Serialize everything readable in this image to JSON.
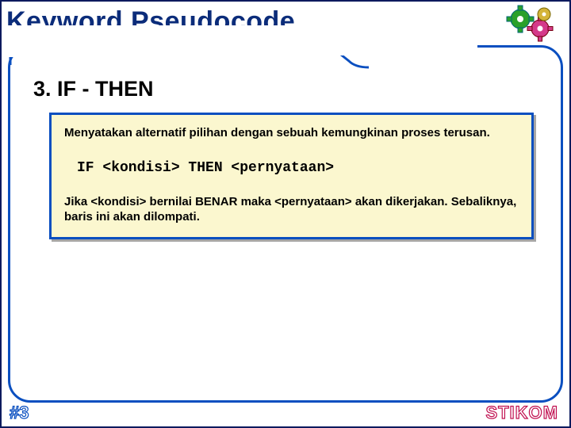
{
  "title": "Keyword Pseudocode",
  "heading": "3. IF - THEN",
  "box": {
    "para1": "Menyatakan alternatif pilihan dengan sebuah kemungkinan proses terusan.",
    "code": "IF <kondisi> THEN <pernyataan>",
    "para2": "Jika <kondisi> bernilai BENAR maka <pernyataan> akan dikerjakan. Sebaliknya, baris ini akan dilompati."
  },
  "footer": {
    "left": "#3",
    "right": "STIKOM"
  },
  "icon": "gears-icon"
}
